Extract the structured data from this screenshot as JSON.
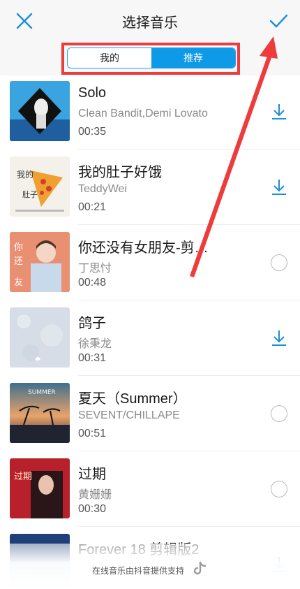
{
  "header": {
    "title": "选择音乐"
  },
  "tabs": {
    "mine": "我的",
    "recommended": "推荐"
  },
  "songs": [
    {
      "title": "Solo",
      "artist": "Clean Bandit,Demi Lovato",
      "duration": "00:35",
      "action": "download"
    },
    {
      "title": "我的肚子好饿",
      "artist": "TeddyWei",
      "duration": "00:21",
      "action": "download"
    },
    {
      "title": "你还没有女朋友-剪…",
      "artist": "丁思忖",
      "duration": "00:48",
      "action": "select"
    },
    {
      "title": "鸽子",
      "artist": "徐秉龙",
      "duration": "00:31",
      "action": "download"
    },
    {
      "title": "夏天（Summer）",
      "artist": "SEVENT/CHILLAPE",
      "duration": "00:51",
      "action": "select"
    },
    {
      "title": "过期",
      "artist": "黄姗姗",
      "duration": "00:30",
      "action": "select"
    },
    {
      "title": "Forever 18 剪辑版2",
      "artist": "",
      "duration": "",
      "action": "download"
    }
  ],
  "footer": {
    "text": "在线音乐由抖音提供支持"
  },
  "colors": {
    "accent": "#0f9ae8",
    "highlight": "#ee3b3b"
  }
}
